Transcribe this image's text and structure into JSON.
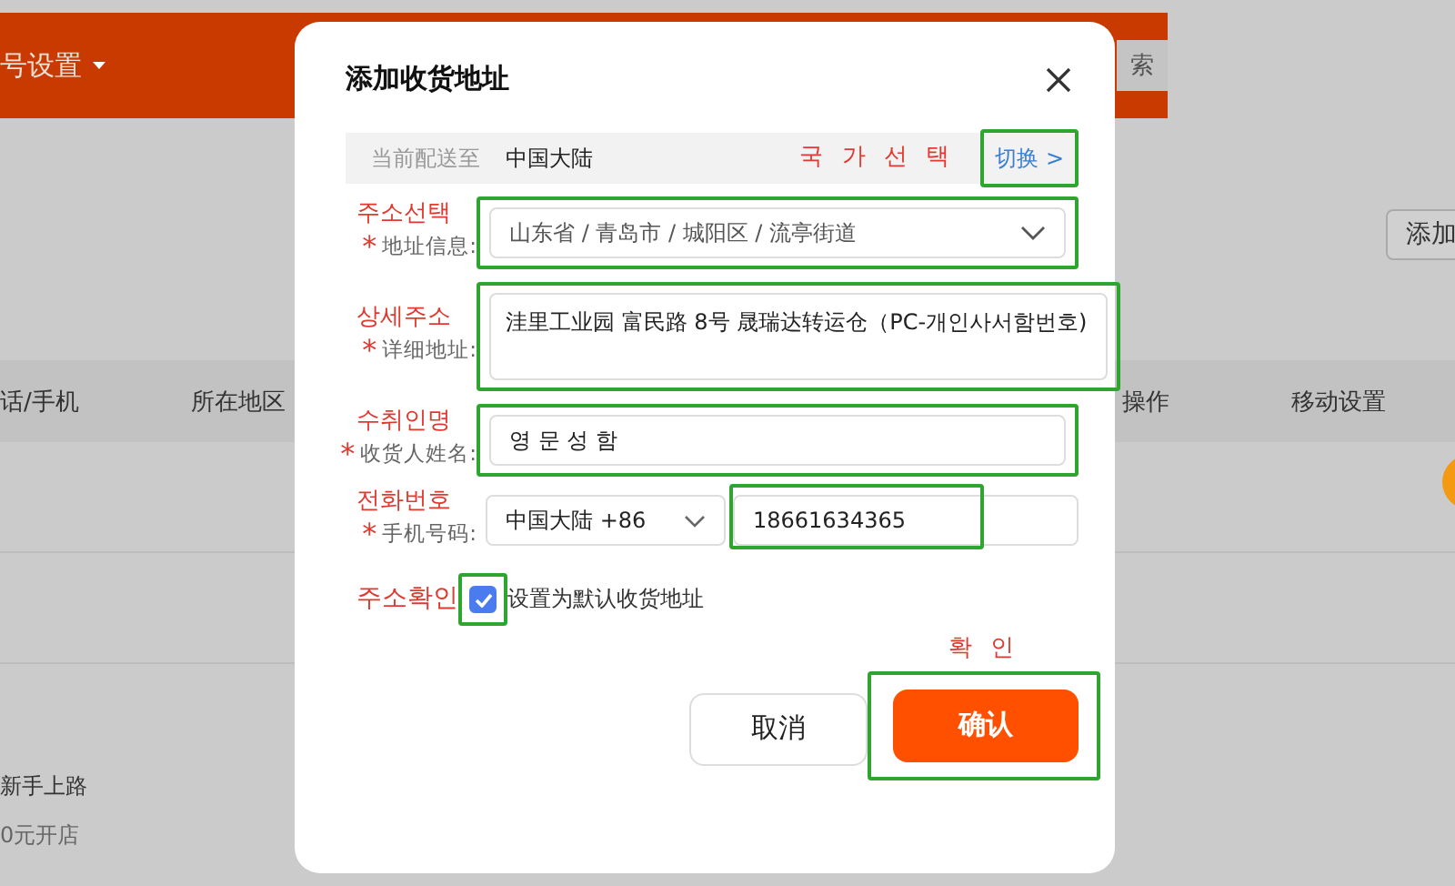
{
  "background_page": {
    "header_title": "号设置",
    "search_text": "索",
    "add_button": "添加",
    "table_columns": [
      "话/手机",
      "所在地区",
      "操作",
      "移动设置"
    ],
    "sidebar_links": [
      "新手上路",
      "0元开店"
    ]
  },
  "dialog": {
    "title": "添加收货地址",
    "delivery": {
      "label": "当前配送至",
      "value": "中国大陆",
      "note": "국 가 선 택",
      "switch_link": "切换 >",
      "highlighted": true
    },
    "fields": [
      {
        "kind": "select",
        "note": "주소선택",
        "label": "地址信息:",
        "required_mark": "*",
        "value": "山东省 / 青岛市 / 城阳区 / 流亭街道",
        "highlighted": true
      },
      {
        "kind": "textarea",
        "note": "상세주소",
        "label": "详细地址:",
        "required_mark": "*",
        "value": "洼里工业园 富民路 8号 晟瑞达转运仓（PC-개인사서함번호)",
        "highlighted": true
      },
      {
        "kind": "input",
        "note": "수취인명",
        "label": "收货人姓名:",
        "required_mark": "*",
        "value": "영 문 성 함",
        "highlighted": true
      },
      {
        "kind": "phone",
        "note": "전화번호",
        "label": "手机号码:",
        "required_mark": "*",
        "region": "中国大陆 +86",
        "value": "18661634365",
        "highlighted": true
      }
    ],
    "default_checkbox": {
      "note": "주소확인",
      "label": "设置为默认收货地址",
      "checked": true,
      "highlighted": true
    },
    "buttons": [
      {
        "kind": "cancel",
        "label": "取消"
      },
      {
        "kind": "confirm",
        "label": "确认",
        "note": "확 인",
        "highlighted": true
      }
    ]
  }
}
